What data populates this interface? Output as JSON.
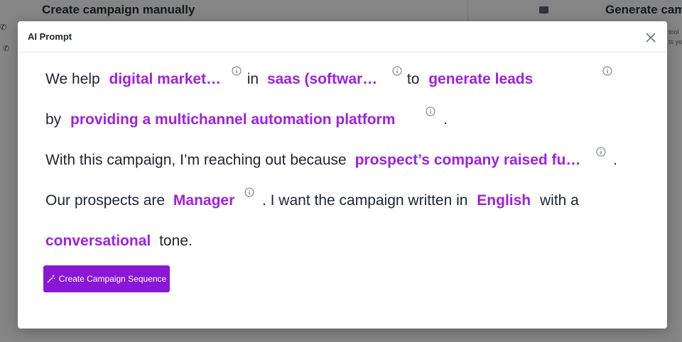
{
  "background": {
    "left_title": "Create campaign manually",
    "right_title": "Generate camp",
    "side_text_1": "tool",
    "side_text_2": "ts yo",
    "phone_glyph": "✆"
  },
  "modal": {
    "title": "AI Prompt",
    "close_icon": "close-icon",
    "prompt": {
      "line1": {
        "t1": "We help",
        "v1": "digital market…",
        "t2": "in",
        "v2": "saas (softwar…",
        "t3": "to",
        "v3": "generate leads"
      },
      "line2": {
        "t1": "by",
        "v1": "providing a multichannel automation platform",
        "t2": "."
      },
      "line3": {
        "t1": "With this campaign, I’m reaching out because",
        "v1": "prospect’s company raised fu…",
        "t2": "."
      },
      "line4": {
        "t1": "Our prospects are",
        "v1": "Manager",
        "t2": ". I want the campaign written in",
        "v2": "English",
        "t3": "with a"
      },
      "line5": {
        "v1": "conversational",
        "t1": "tone."
      }
    },
    "create_button": "Create Campaign Sequence",
    "colors": {
      "accent": "#a020e0",
      "button": "#8a17d6",
      "text": "#1d2433"
    }
  }
}
